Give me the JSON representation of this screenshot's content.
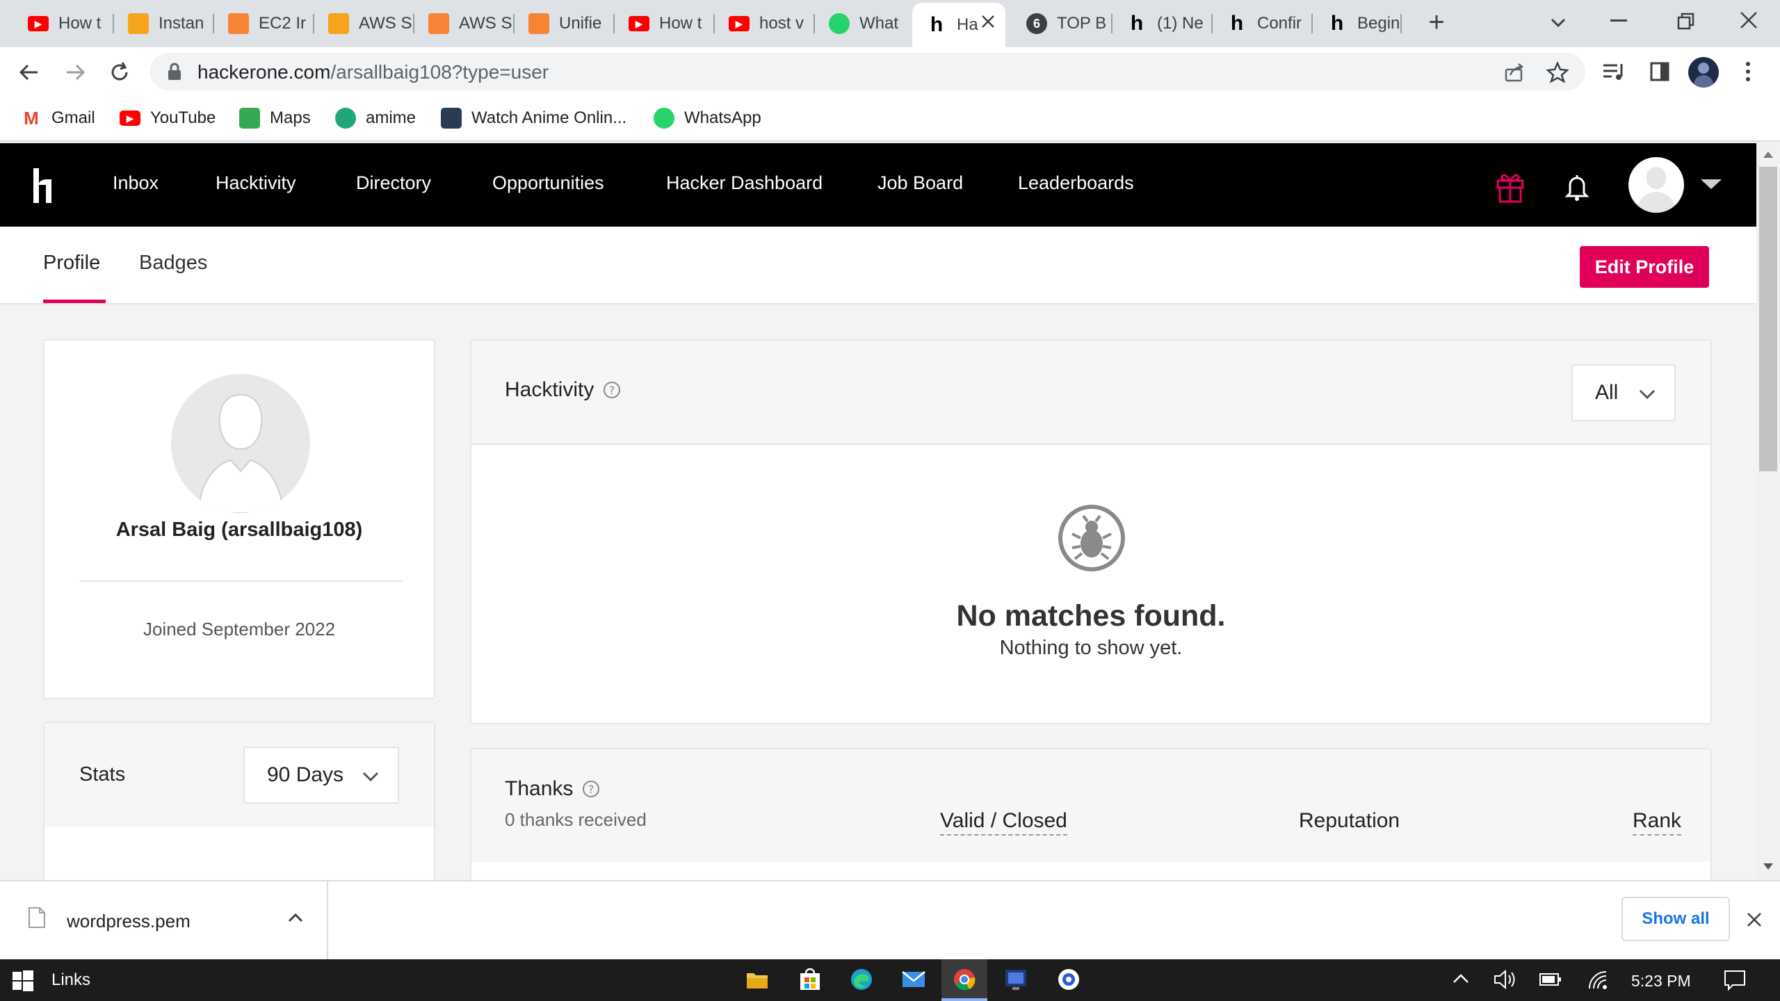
{
  "browser": {
    "tabs": [
      {
        "label": "How t",
        "icon": "youtube-icon",
        "color": "#ff0000"
      },
      {
        "label": "Instan",
        "icon": "aws-box-icon",
        "color": "#f7a41d"
      },
      {
        "label": "EC2 Ir",
        "icon": "aws-ec2-icon",
        "color": "#f58534"
      },
      {
        "label": "AWS S",
        "icon": "aws-box-icon",
        "color": "#f7a41d"
      },
      {
        "label": "AWS S",
        "icon": "aws-ec2-icon",
        "color": "#f58534"
      },
      {
        "label": "Unifie",
        "icon": "aws-ec2-icon",
        "color": "#f58534"
      },
      {
        "label": "How t",
        "icon": "youtube-icon",
        "color": "#ff0000"
      },
      {
        "label": "host v",
        "icon": "youtube-icon",
        "color": "#ff0000"
      },
      {
        "label": "What",
        "icon": "whatsapp-icon",
        "color": "#25d366"
      },
      {
        "label": "Ha",
        "icon": "hackerone-icon",
        "color": "#000000"
      },
      {
        "label": "TOP B",
        "icon": "medium-icon",
        "color": "#3c4043"
      },
      {
        "label": "(1) Ne",
        "icon": "hackerone-icon",
        "color": "#000000"
      },
      {
        "label": "Confir",
        "icon": "hackerone-icon",
        "color": "#000000"
      },
      {
        "label": "Begin",
        "icon": "hackerone-icon",
        "color": "#000000"
      }
    ],
    "url_domain": "hackerone.com",
    "url_path": "/arsallbaig108?type=user",
    "bookmarks": [
      {
        "label": "Gmail",
        "icon": "gmail-icon",
        "color": "#ea4335"
      },
      {
        "label": "YouTube",
        "icon": "youtube-icon",
        "color": "#ff0000"
      },
      {
        "label": "Maps",
        "icon": "maps-icon",
        "color": "#34a853"
      },
      {
        "label": "amime",
        "icon": "anime-icon",
        "color": "#1fa67a"
      },
      {
        "label": "Watch Anime Onlin...",
        "icon": "anime-site-icon",
        "color": "#2b3a55"
      },
      {
        "label": "WhatsApp",
        "icon": "whatsapp-icon",
        "color": "#25d366"
      }
    ]
  },
  "site": {
    "logo": "h1",
    "nav": [
      "Inbox",
      "Hacktivity",
      "Directory",
      "Opportunities",
      "Hacker Dashboard",
      "Job Board",
      "Leaderboards"
    ],
    "accent": "#e0005a"
  },
  "subnav": {
    "tabs": [
      "Profile",
      "Badges"
    ],
    "active": "Profile",
    "edit_button": "Edit Profile"
  },
  "profile": {
    "name": "Arsal Baig (arsallbaig108)",
    "joined": "Joined September 2022"
  },
  "stats": {
    "title": "Stats",
    "period": "90 Days"
  },
  "hacktivity": {
    "title": "Hacktivity",
    "filter": "All",
    "empty_title": "No matches found.",
    "empty_subtitle": "Nothing to show yet."
  },
  "thanks": {
    "title": "Thanks",
    "count_text": "0 thanks received",
    "columns": [
      "Valid / Closed",
      "Reputation",
      "Rank"
    ]
  },
  "downloads": {
    "file": "wordpress.pem",
    "show_all": "Show all"
  },
  "taskbar": {
    "search_label": "Links",
    "time": "5:23 PM"
  }
}
